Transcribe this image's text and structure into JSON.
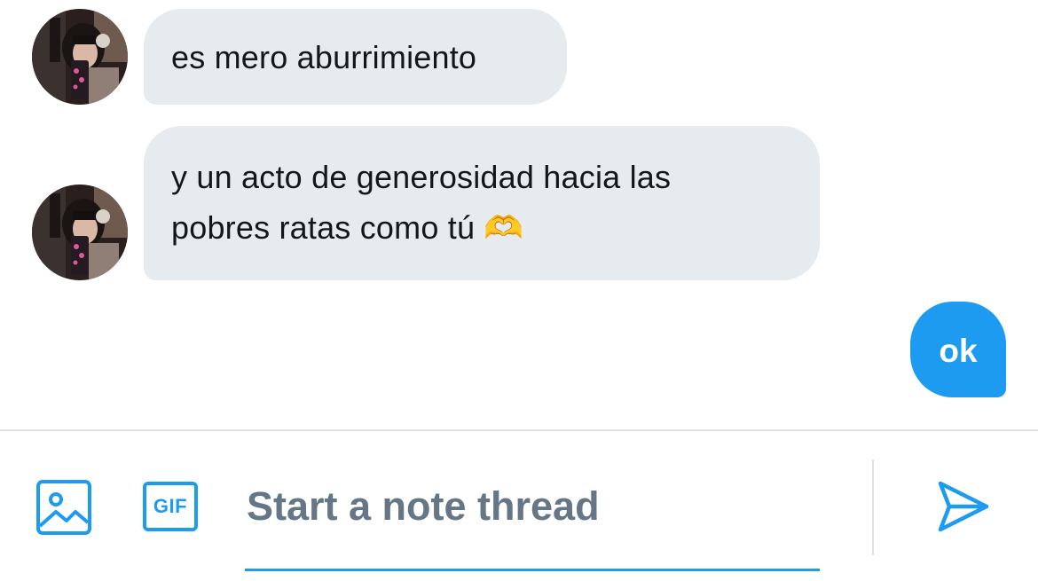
{
  "messages": [
    {
      "direction": "incoming",
      "lines": [
        "es mero aburrimiento"
      ]
    },
    {
      "direction": "incoming",
      "lines": [
        "y un acto de generosidad hacia las",
        "pobres ratas como tú"
      ],
      "emoji": "🫶"
    },
    {
      "direction": "outgoing",
      "text": "ok"
    }
  ],
  "composer": {
    "placeholder": "Start a note thread",
    "gif_label": "GIF",
    "icons": {
      "image": "image-icon",
      "gif": "gif-icon",
      "send": "send-icon"
    }
  },
  "colors": {
    "accent": "#1d9bf0",
    "incoming_bubble": "#e6ebef",
    "placeholder": "#657786",
    "text": "#14171a"
  }
}
